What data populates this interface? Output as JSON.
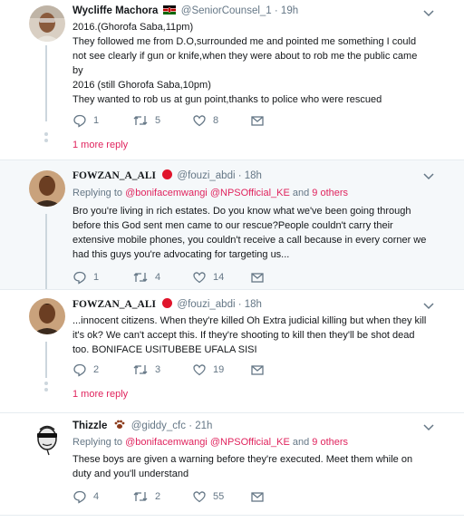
{
  "tweets": [
    {
      "name": "Wycliffe Machora",
      "handle": "@SeniorCounsel_1",
      "time": "19h",
      "lines": [
        "2016.(Ghorofa Saba,11pm)",
        "They followed me from D.O,surrounded me and pointed me something I could",
        "not see clearly if gun or knife,when they were about to rob me the public came",
        "by",
        "2016 (still Ghorofa Saba,10pm)",
        "They wanted to rob us at gun point,thanks to police who were rescued"
      ],
      "replies": "1",
      "retweets": "5",
      "likes": "8",
      "more_replies": "1 more reply"
    },
    {
      "name": "FOWZAN_A_ALI",
      "handle": "@fouzi_abdi",
      "time": "18h",
      "replying_prefix": "Replying to ",
      "replying_user1": "@bonifacemwangi",
      "replying_user2": "@NPSOfficial_KE",
      "replying_and": " and ",
      "replying_others": "9 others",
      "lines": [
        "Bro you're living in rich estates. Do you know what we've been going through",
        "before this God sent men came to our rescue?People couldn't carry their",
        "extensive mobile phones, you couldn't receive a call because in every corner we",
        "had this guys you're advocating for targeting us..."
      ],
      "replies": "1",
      "retweets": "4",
      "likes": "14"
    },
    {
      "name": "FOWZAN_A_ALI",
      "handle": "@fouzi_abdi",
      "time": "18h",
      "lines": [
        "...innocent citizens. When they're killed Oh Extra judicial killing but when they kill",
        "it's ok? We can't accept this. If they're shooting to kill then they'll be shot dead",
        "too. BONIFACE USITUBEBE UFALA SISI"
      ],
      "replies": "2",
      "retweets": "3",
      "likes": "19",
      "more_replies": "1 more reply"
    },
    {
      "name": "Thizzle",
      "handle": "@giddy_cfc",
      "time": "21h",
      "replying_prefix": "Replying to ",
      "replying_user1": "@bonifacemwangi",
      "replying_user2": "@NPSOfficial_KE",
      "replying_and": " and ",
      "replying_others": "9 others",
      "lines": [
        "These boys are given a warning before they're executed.  Meet them while on",
        "duty and you'll understand"
      ],
      "replies": "4",
      "retweets": "2",
      "likes": "55"
    }
  ],
  "colors": {
    "accent": "#e0245e",
    "muted": "#657786",
    "border": "#e6ecf0",
    "highlight": "#f5f8fa"
  }
}
